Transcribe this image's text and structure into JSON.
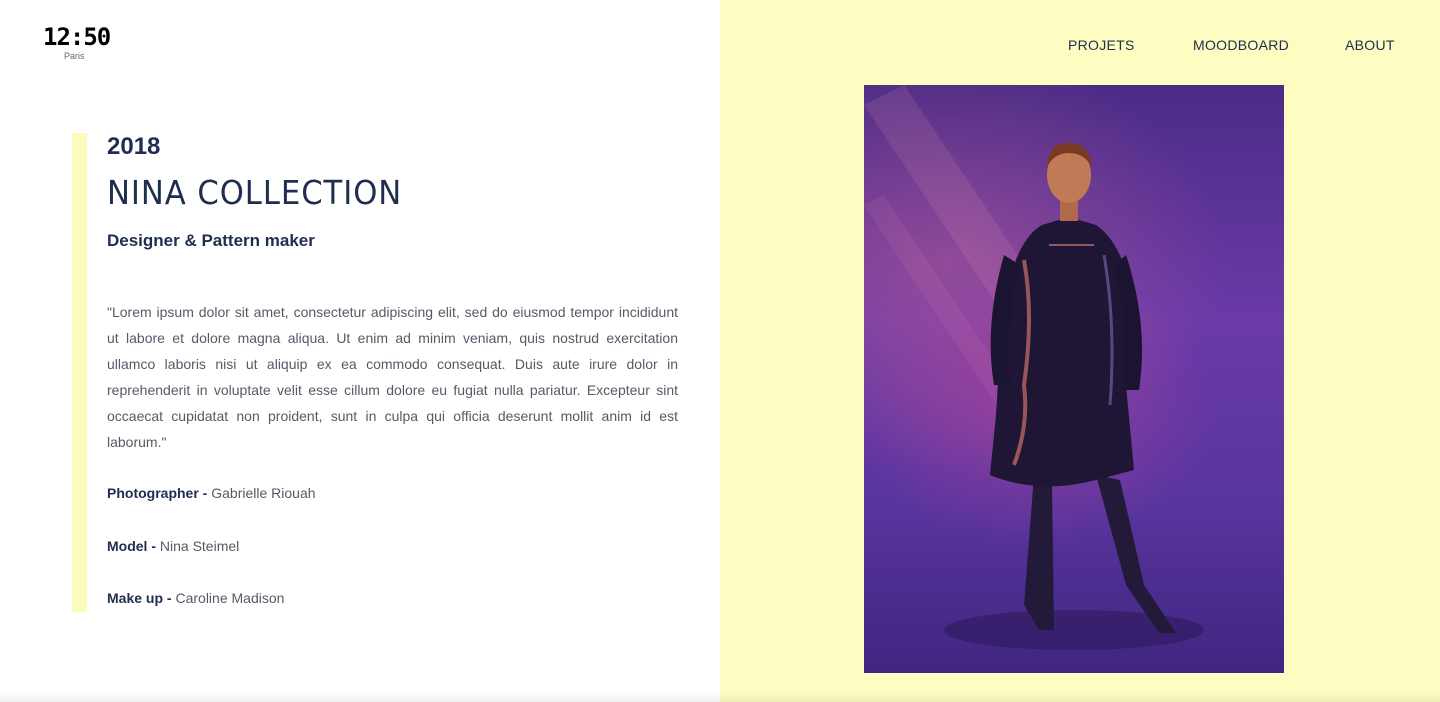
{
  "logo": {
    "time": "12:50",
    "city": "Paris"
  },
  "nav": {
    "items": [
      {
        "label": "PROJETS"
      },
      {
        "label": "MOODBOARD"
      },
      {
        "label": "ABOUT"
      }
    ]
  },
  "project": {
    "year": "2018",
    "title": "NINA COLLECTION",
    "role": "Designer & Pattern maker",
    "description": "\"Lorem ipsum dolor sit amet, consectetur adipiscing elit, sed do eiusmod tempor incididunt ut labore et dolore magna aliqua. Ut enim ad minim veniam, quis nostrud exercitation ullamco laboris nisi ut aliquip ex ea commodo consequat. Duis aute irure dolor in reprehenderit in voluptate velit esse cillum dolore eu fugiat nulla pariatur. Excepteur sint occaecat cupidatat non proident, sunt in culpa qui officia deserunt mollit anim id est laborum.\"",
    "credits": [
      {
        "role": "Photographer - ",
        "name": "Gabrielle Riouah"
      },
      {
        "role": "Model - ",
        "name": "Nina Steimel"
      },
      {
        "role": "Make up - ",
        "name": "Caroline Madison"
      }
    ]
  },
  "colors": {
    "accent_yellow": "#fdfcc1",
    "navy": "#1f2d4f",
    "photo_purple": "#5a35a0"
  }
}
